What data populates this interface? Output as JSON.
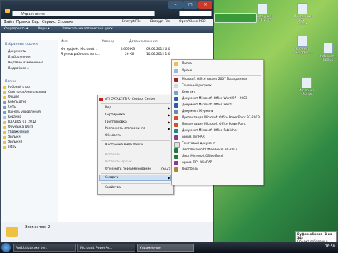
{
  "window": {
    "title": "Упражнение",
    "address": "Упражнение",
    "controls": [
      "–",
      "□",
      "✕"
    ]
  },
  "menubar": [
    "Файл",
    "Правка",
    "Вид",
    "Сервис",
    "Справка"
  ],
  "extras": [
    "Encrypt File",
    "Decrypt File",
    "Open/Close PGD"
  ],
  "toolbar": [
    "Упорядочить ▾",
    "Виды ▾",
    "Записать на оптический диск"
  ],
  "nav": {
    "favorites_header": "Избранные ссылки",
    "favorites": [
      "Документы",
      "Изображения",
      "Недавно изменённые",
      "Подробнее »"
    ],
    "folders_header": "Папки",
    "folders": [
      "Рабочий стол",
      "Светлана Анатольевна",
      "Общие",
      "Компьютер",
      "Сеть",
      "Панель управления",
      "Корзина",
      "ВЛАД05_01_2012",
      "Обучалка Word",
      "Упражнение",
      "Ярлыки",
      "Ярлыки2",
      "listov"
    ]
  },
  "list": {
    "columns": [
      "Имя",
      "Размер",
      "Дата изменения"
    ],
    "rows": [
      {
        "name": "Интерфейс Microsoft ...",
        "size": "4 666 КБ",
        "date": "09.06.2012 0:0"
      },
      {
        "name": "Я учусь работать на к...",
        "size": "26 КБ",
        "date": "10.06.2012 1:0"
      }
    ]
  },
  "status": "Элементов: 2",
  "context_menu": {
    "top_item": "ATI CATALYST(R) Control Center",
    "items": [
      "Вид",
      "Сортировка",
      "Группировка",
      "Разложить стопками по",
      "Обновить",
      "Настройка вида папки...",
      "Вставить",
      "Вставить ярлык",
      "Отменить переименование",
      "Создать",
      "Свойства"
    ],
    "shortcut": "Ctrl+Z"
  },
  "submenu": [
    "Папка",
    "Ярлык",
    "Microsoft Office Access 2007 База данных",
    "Точечный рисунок",
    "Контакт",
    "Документ Microsoft Office Word 97 - 2003",
    "Документ Microsoft Office Word",
    "Документ Журнала",
    "Презентация Microsoft Office PowerPoint 97-2003",
    "Презентация Microsoft Office PowerPoint",
    "Документ Microsoft Office Publisher",
    "Архив WinRAR",
    "Текстовый документ",
    "Лист Microsoft Office Excel 97-2003",
    "Лист Microsoft Office Excel",
    "Архив ZIP - WinRAR",
    "Портфель"
  ],
  "desktop_icons": [
    "Инструкция по ТБ и ОТ",
    "Инструкция 401 - Ярлык",
    "Кабинет информат...",
    "Интернет - Ярлык",
    "Кабинет - Ярлык"
  ],
  "notification": {
    "title": "Буфер обмена (1 из 24)",
    "text": "Объект добавлен в буфер"
  },
  "taskbar": {
    "tasks": [
      "AptUpdate.exe ver...",
      "Microsoft PowerPo...",
      "Упражнение"
    ],
    "clock": "16:50"
  }
}
